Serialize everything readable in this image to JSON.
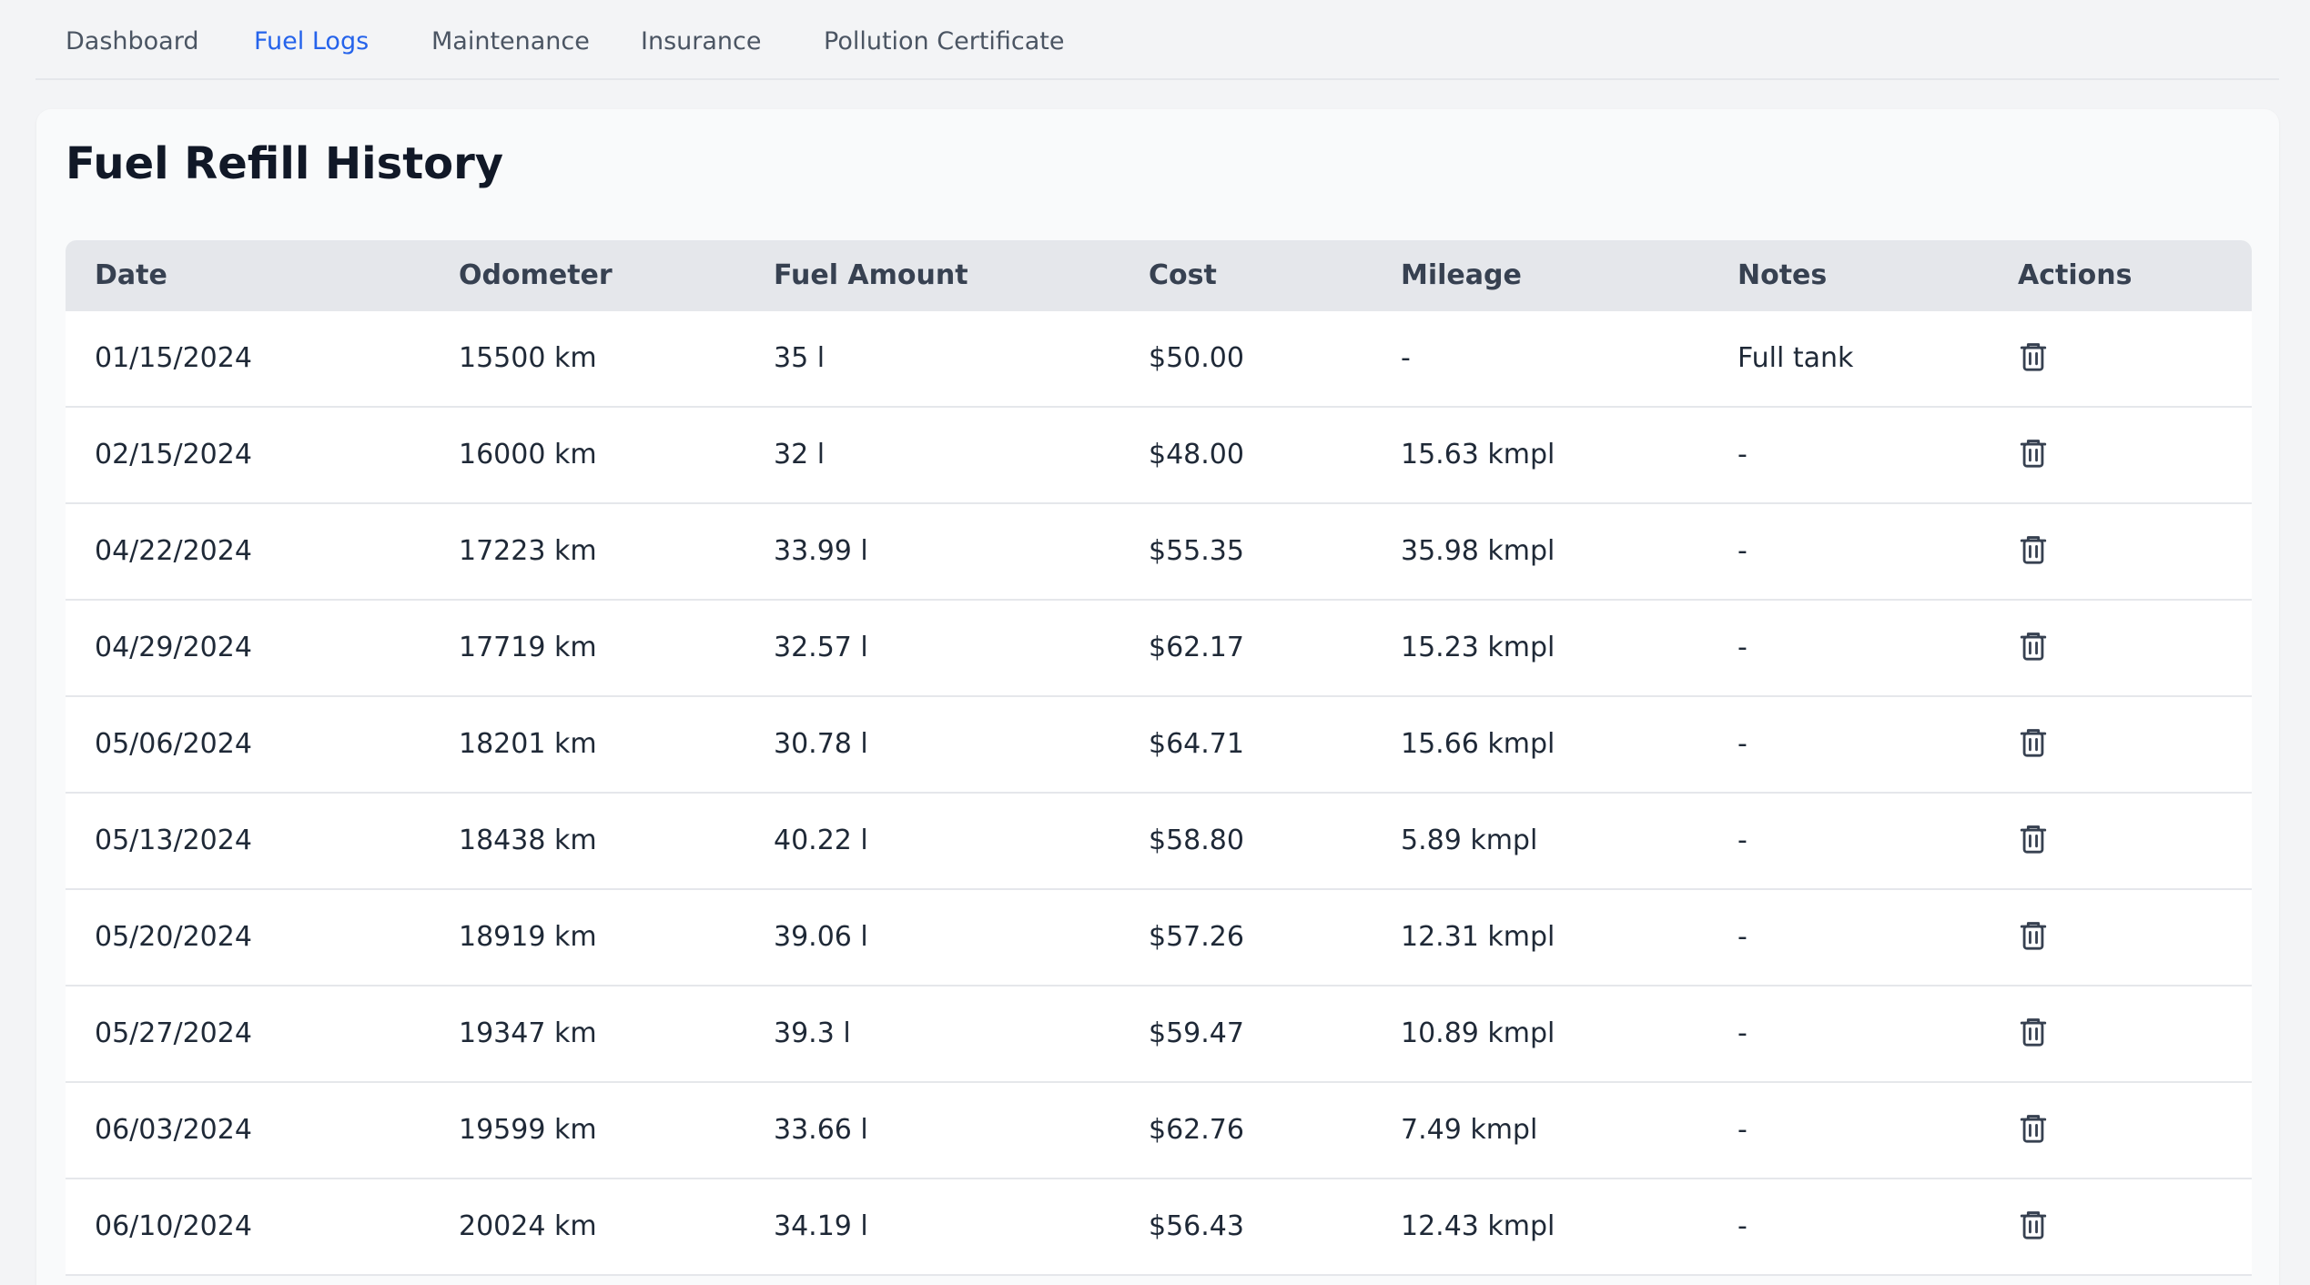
{
  "nav": {
    "tabs": [
      {
        "label": "Dashboard"
      },
      {
        "label": "Fuel Logs",
        "active": true
      },
      {
        "label": "Maintenance"
      },
      {
        "label": "Insurance"
      },
      {
        "label": "Pollution Certificate"
      }
    ]
  },
  "main": {
    "title": "Fuel Refill History",
    "table": {
      "headers": [
        "Date",
        "Odometer",
        "Fuel Amount",
        "Cost",
        "Mileage",
        "Notes",
        "Actions"
      ],
      "rows": [
        {
          "date": "01/15/2024",
          "odometer": "15500 km",
          "fuel": "35 l",
          "cost": "$50.00",
          "mileage": "-",
          "notes": "Full tank"
        },
        {
          "date": "02/15/2024",
          "odometer": "16000 km",
          "fuel": "32 l",
          "cost": "$48.00",
          "mileage": "15.63 kmpl",
          "notes": "-"
        },
        {
          "date": "04/22/2024",
          "odometer": "17223 km",
          "fuel": "33.99 l",
          "cost": "$55.35",
          "mileage": "35.98 kmpl",
          "notes": "-"
        },
        {
          "date": "04/29/2024",
          "odometer": "17719 km",
          "fuel": "32.57 l",
          "cost": "$62.17",
          "mileage": "15.23 kmpl",
          "notes": "-"
        },
        {
          "date": "05/06/2024",
          "odometer": "18201 km",
          "fuel": "30.78 l",
          "cost": "$64.71",
          "mileage": "15.66 kmpl",
          "notes": "-"
        },
        {
          "date": "05/13/2024",
          "odometer": "18438 km",
          "fuel": "40.22 l",
          "cost": "$58.80",
          "mileage": "5.89 kmpl",
          "notes": "-"
        },
        {
          "date": "05/20/2024",
          "odometer": "18919 km",
          "fuel": "39.06 l",
          "cost": "$57.26",
          "mileage": "12.31 kmpl",
          "notes": "-"
        },
        {
          "date": "05/27/2024",
          "odometer": "19347 km",
          "fuel": "39.3 l",
          "cost": "$59.47",
          "mileage": "10.89 kmpl",
          "notes": "-"
        },
        {
          "date": "06/03/2024",
          "odometer": "19599 km",
          "fuel": "33.66 l",
          "cost": "$62.76",
          "mileage": "7.49 kmpl",
          "notes": "-"
        },
        {
          "date": "06/10/2024",
          "odometer": "20024 km",
          "fuel": "34.19 l",
          "cost": "$56.43",
          "mileage": "12.43 kmpl",
          "notes": "-"
        }
      ]
    }
  },
  "icons": {
    "delete": "trash-icon"
  },
  "colors": {
    "accent": "#2563eb",
    "background": "#f3f4f6",
    "header_bg": "#e5e7eb"
  }
}
